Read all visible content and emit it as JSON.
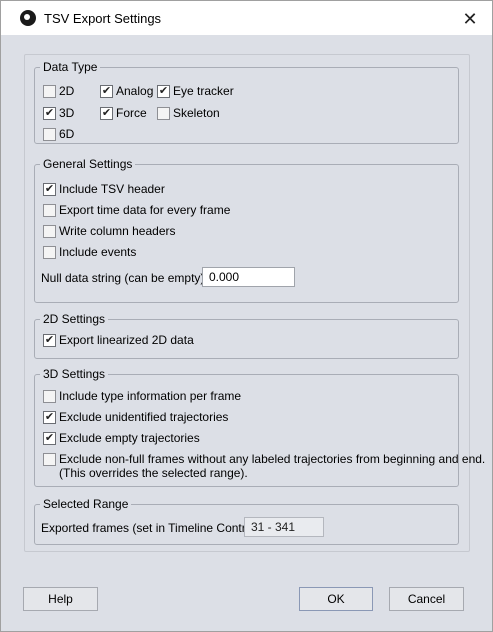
{
  "window": {
    "title": "TSV Export Settings",
    "close_glyph": "✕",
    "icon": "app-logo-icon"
  },
  "data_type": {
    "legend": "Data Type",
    "items": [
      {
        "label": "2D",
        "checked": false
      },
      {
        "label": "Analog",
        "checked": true
      },
      {
        "label": "Eye tracker",
        "checked": true
      },
      {
        "label": "3D",
        "checked": true
      },
      {
        "label": "Force",
        "checked": true
      },
      {
        "label": "Skeleton",
        "checked": false
      },
      {
        "label": "6D",
        "checked": false
      }
    ]
  },
  "general": {
    "legend": "General Settings",
    "items": [
      {
        "label": "Include TSV header",
        "checked": true
      },
      {
        "label": "Export time data for every frame",
        "checked": false
      },
      {
        "label": "Write column headers",
        "checked": false
      },
      {
        "label": "Include events",
        "checked": false
      }
    ],
    "null_label": "Null data string (can be empty):",
    "null_value": "0.000"
  },
  "settings2d": {
    "legend": "2D Settings",
    "items": [
      {
        "label": "Export linearized 2D data",
        "checked": true
      }
    ]
  },
  "settings3d": {
    "legend": "3D Settings",
    "items": [
      {
        "label": "Include type information per frame",
        "checked": false
      },
      {
        "label": "Exclude unidentified trajectories",
        "checked": true
      },
      {
        "label": "Exclude empty trajectories",
        "checked": true
      },
      {
        "label": "Exclude non-full frames without any labeled trajectories from beginning and end.",
        "checked": false
      }
    ],
    "note": "(This overrides the selected range)."
  },
  "range": {
    "legend": "Selected Range",
    "label": "Exported frames (set in Timeline Control)",
    "value": "31 - 341"
  },
  "buttons": {
    "help": "Help",
    "ok": "OK",
    "cancel": "Cancel"
  },
  "check_glyph": "✔"
}
